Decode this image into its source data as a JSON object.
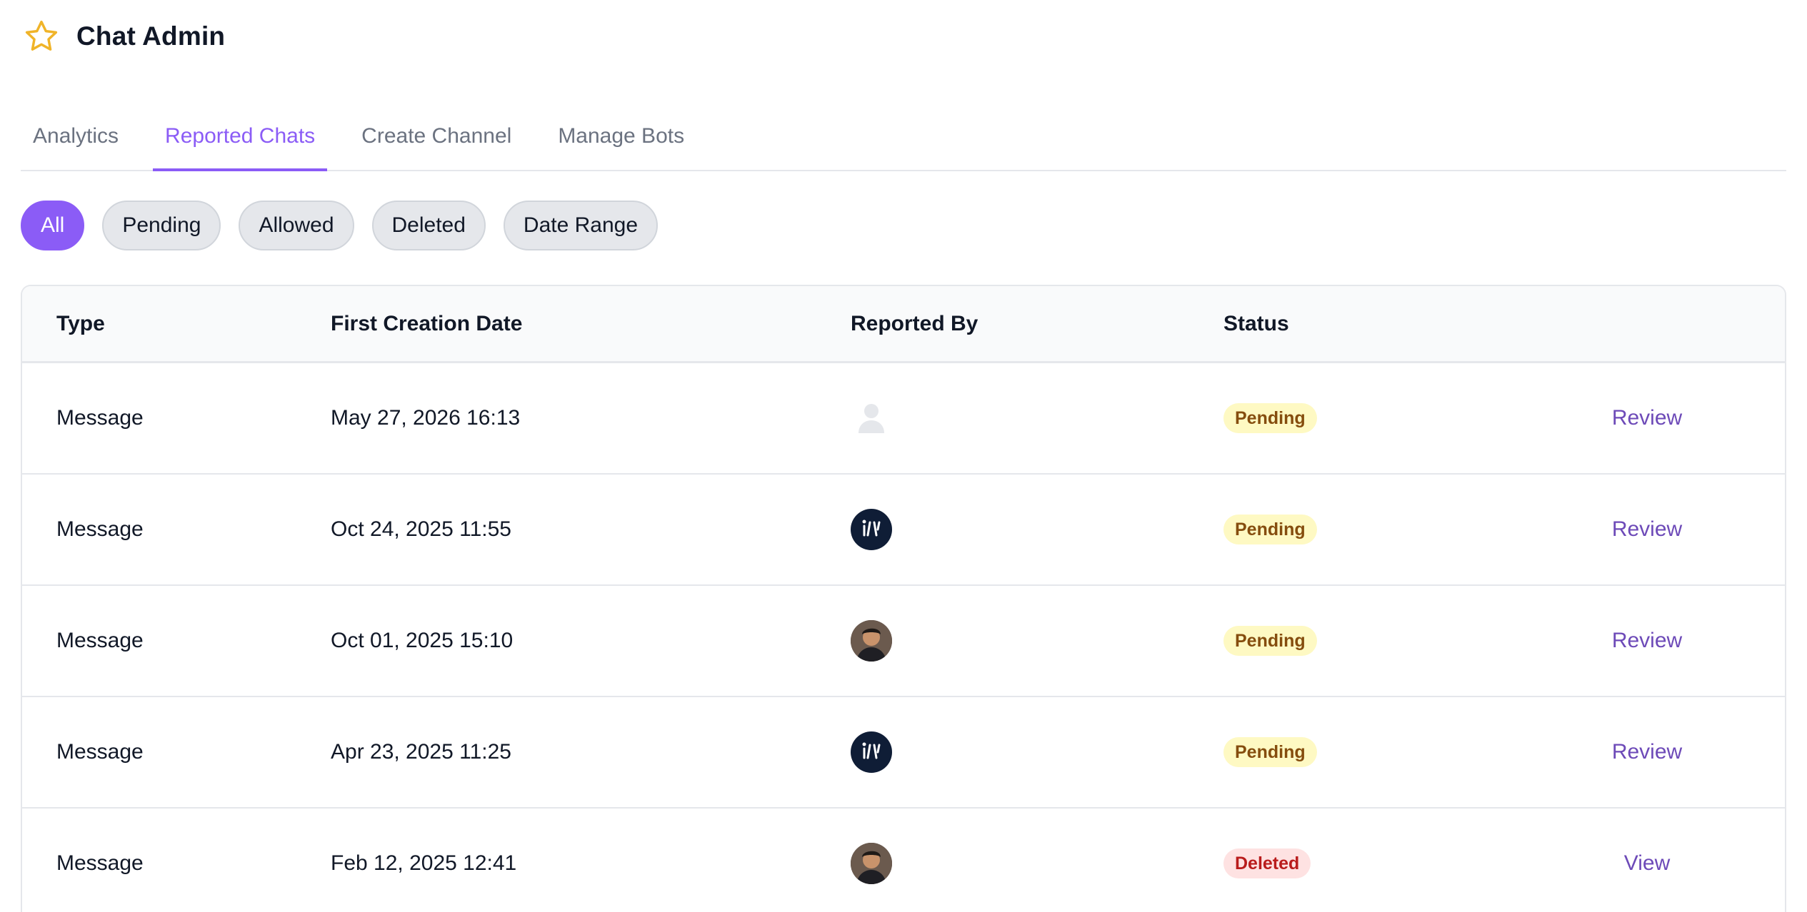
{
  "app": {
    "title": "Chat Admin",
    "icon": "star-icon"
  },
  "tabs": [
    {
      "label": "Analytics",
      "active": false
    },
    {
      "label": "Reported Chats",
      "active": true
    },
    {
      "label": "Create Channel",
      "active": false
    },
    {
      "label": "Manage Bots",
      "active": false
    }
  ],
  "filters": [
    {
      "label": "All",
      "active": true
    },
    {
      "label": "Pending",
      "active": false
    },
    {
      "label": "Allowed",
      "active": false
    },
    {
      "label": "Deleted",
      "active": false
    },
    {
      "label": "Date Range",
      "active": false
    }
  ],
  "table": {
    "columns": [
      "Type",
      "First Creation Date",
      "Reported By",
      "Status",
      ""
    ],
    "rows": [
      {
        "type": "Message",
        "date": "May 27, 2026 16:13",
        "reporter_avatar": "default-user-avatar",
        "status": "Pending",
        "action": "Review"
      },
      {
        "type": "Message",
        "date": "Oct 24, 2025 11:55",
        "reporter_avatar": "logo-avatar",
        "status": "Pending",
        "action": "Review"
      },
      {
        "type": "Message",
        "date": "Oct 01, 2025 15:10",
        "reporter_avatar": "photo-avatar",
        "status": "Pending",
        "action": "Review"
      },
      {
        "type": "Message",
        "date": "Apr 23, 2025 11:25",
        "reporter_avatar": "logo-avatar",
        "status": "Pending",
        "action": "Review"
      },
      {
        "type": "Message",
        "date": "Feb 12, 2025 12:41",
        "reporter_avatar": "photo-avatar",
        "status": "Deleted",
        "action": "View"
      }
    ]
  },
  "colors": {
    "accent": "#8b5cf6",
    "link": "#6d4ab8",
    "pending_bg": "#fef9c3",
    "pending_text": "#854d0e",
    "deleted_bg": "#fee2e2",
    "deleted_text": "#b91c1c",
    "star": "#f0b429"
  }
}
